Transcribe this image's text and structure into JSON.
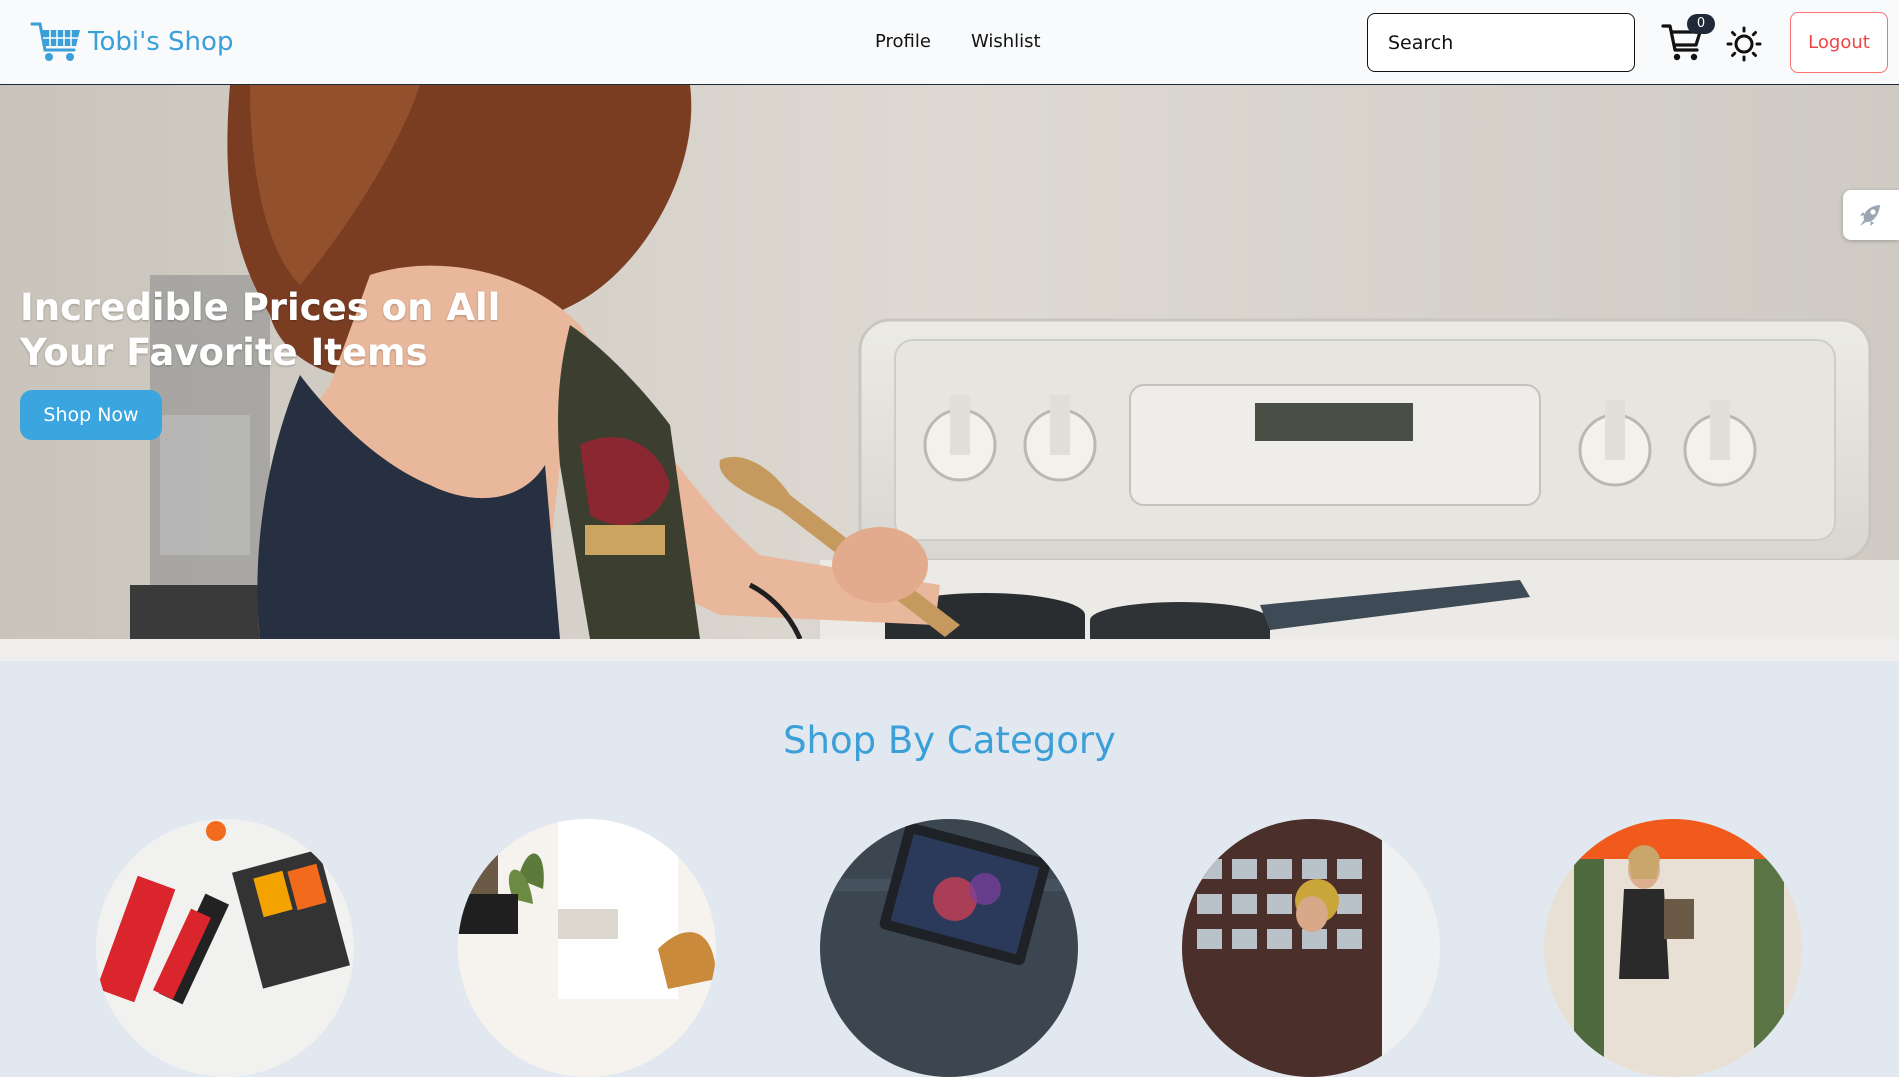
{
  "brand": {
    "name": "Tobi's Shop",
    "icon": "shopping-cart-icon",
    "color": "#3b9fd8"
  },
  "nav": {
    "links": [
      {
        "label": "Profile"
      },
      {
        "label": "Wishlist"
      }
    ]
  },
  "search": {
    "placeholder": "Search"
  },
  "cart": {
    "icon": "cart-icon",
    "count": "0"
  },
  "theme_toggle": {
    "icon": "sun-icon"
  },
  "logout": {
    "label": "Logout",
    "color": "#ef4444"
  },
  "hero": {
    "title": "Incredible Prices on All Your Favorite Items",
    "cta_label": "Shop Now",
    "cta_color": "#3ba5e0"
  },
  "side_tab": {
    "icon": "rocket-icon"
  },
  "categories": {
    "title": "Shop By Category",
    "items": [
      {
        "icon": "office-supplies-image"
      },
      {
        "icon": "home-decor-image"
      },
      {
        "icon": "laptop-image"
      },
      {
        "icon": "city-person-image"
      },
      {
        "icon": "fashion-shopping-image"
      }
    ]
  }
}
